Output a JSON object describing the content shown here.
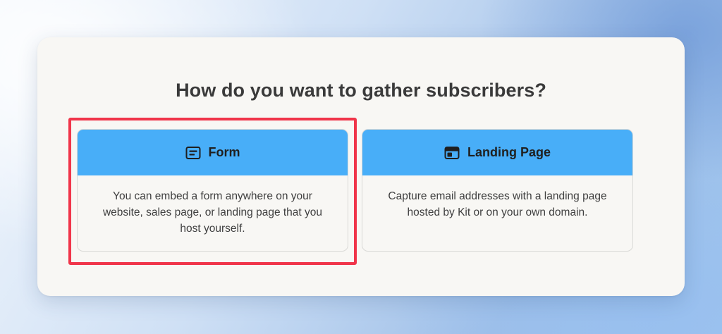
{
  "modal": {
    "title": "How do you want to gather subscribers?"
  },
  "options": [
    {
      "icon": "form-icon",
      "label": "Form",
      "description": "You can embed a form anywhere on your website, sales page, or landing page that you host yourself.",
      "highlighted": true
    },
    {
      "icon": "landing-page-icon",
      "label": "Landing Page",
      "description": "Capture email addresses with a landing page hosted by Kit or on your own domain.",
      "highlighted": false
    }
  ],
  "colors": {
    "header_blue": "#48aef8",
    "highlight_red": "#f0354a",
    "modal_bg": "#f8f7f4"
  }
}
